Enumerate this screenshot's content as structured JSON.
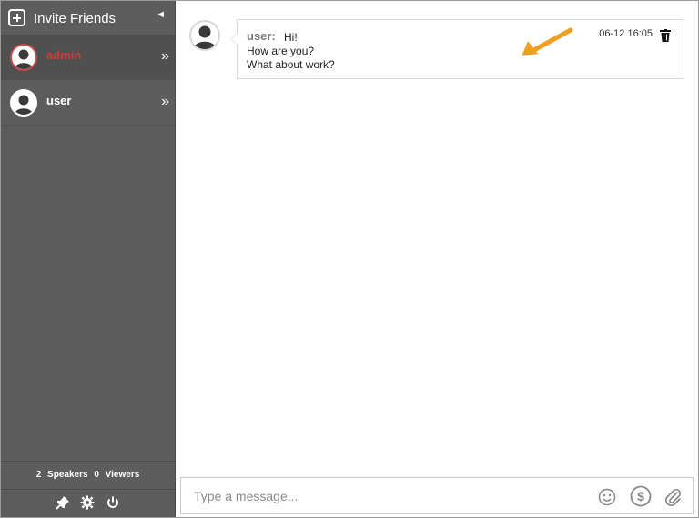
{
  "sidebar": {
    "invite_label": "Invite Friends",
    "collapse_glyph": "◄",
    "users": [
      {
        "name": "admin",
        "status_color": "#cc3b3b",
        "expand_glyph": "»"
      },
      {
        "name": "user",
        "status_color": "#ffffff",
        "expand_glyph": "»"
      }
    ],
    "counts": {
      "speakers_value": "2",
      "speakers_label": "Speakers",
      "viewers_value": "0",
      "viewers_label": "Viewers"
    },
    "tools": [
      "pin-icon",
      "gear-icon",
      "power-icon"
    ]
  },
  "chat": {
    "messages": [
      {
        "author": "user:",
        "lines": [
          "Hi!",
          "How are you?",
          "What about work?"
        ],
        "timestamp": "06-12 16:05"
      }
    ],
    "annotation_color": "#f0a020"
  },
  "composer": {
    "placeholder": "Type a message...",
    "icons": [
      "emoji-icon",
      "dollar-icon",
      "attachment-icon"
    ]
  }
}
